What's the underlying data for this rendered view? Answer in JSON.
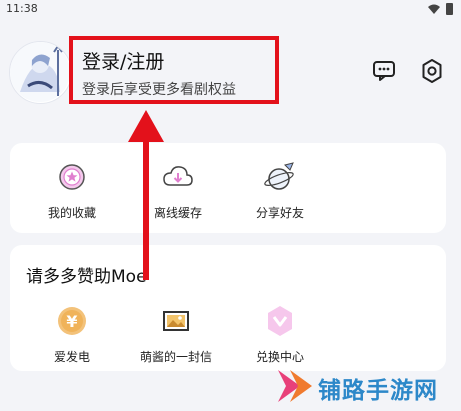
{
  "status_bar": {
    "time": "11:38"
  },
  "profile": {
    "title": "登录/注册",
    "subtitle": "登录后享受更多看剧权益"
  },
  "header_actions": {
    "message_icon": "chat-bubble-icon",
    "settings_icon": "gear-icon"
  },
  "quick_actions": [
    {
      "label": "我的收藏",
      "icon": "star-badge-icon"
    },
    {
      "label": "离线缓存",
      "icon": "cloud-download-icon"
    },
    {
      "label": "分享好友",
      "icon": "share-planet-icon"
    }
  ],
  "support": {
    "title": "请多多赞助Moe",
    "items": [
      {
        "label": "爱发电",
        "icon": "yen-coin-icon"
      },
      {
        "label": "萌酱的一封信",
        "icon": "letter-picture-icon"
      },
      {
        "label": "兑换中心",
        "icon": "exchange-badge-icon"
      }
    ]
  },
  "watermark": {
    "text": "铺路手游网"
  },
  "colors": {
    "highlight": "#e3111b",
    "watermark": "#2d88c9",
    "accent_pink": "#f2a7d8"
  }
}
